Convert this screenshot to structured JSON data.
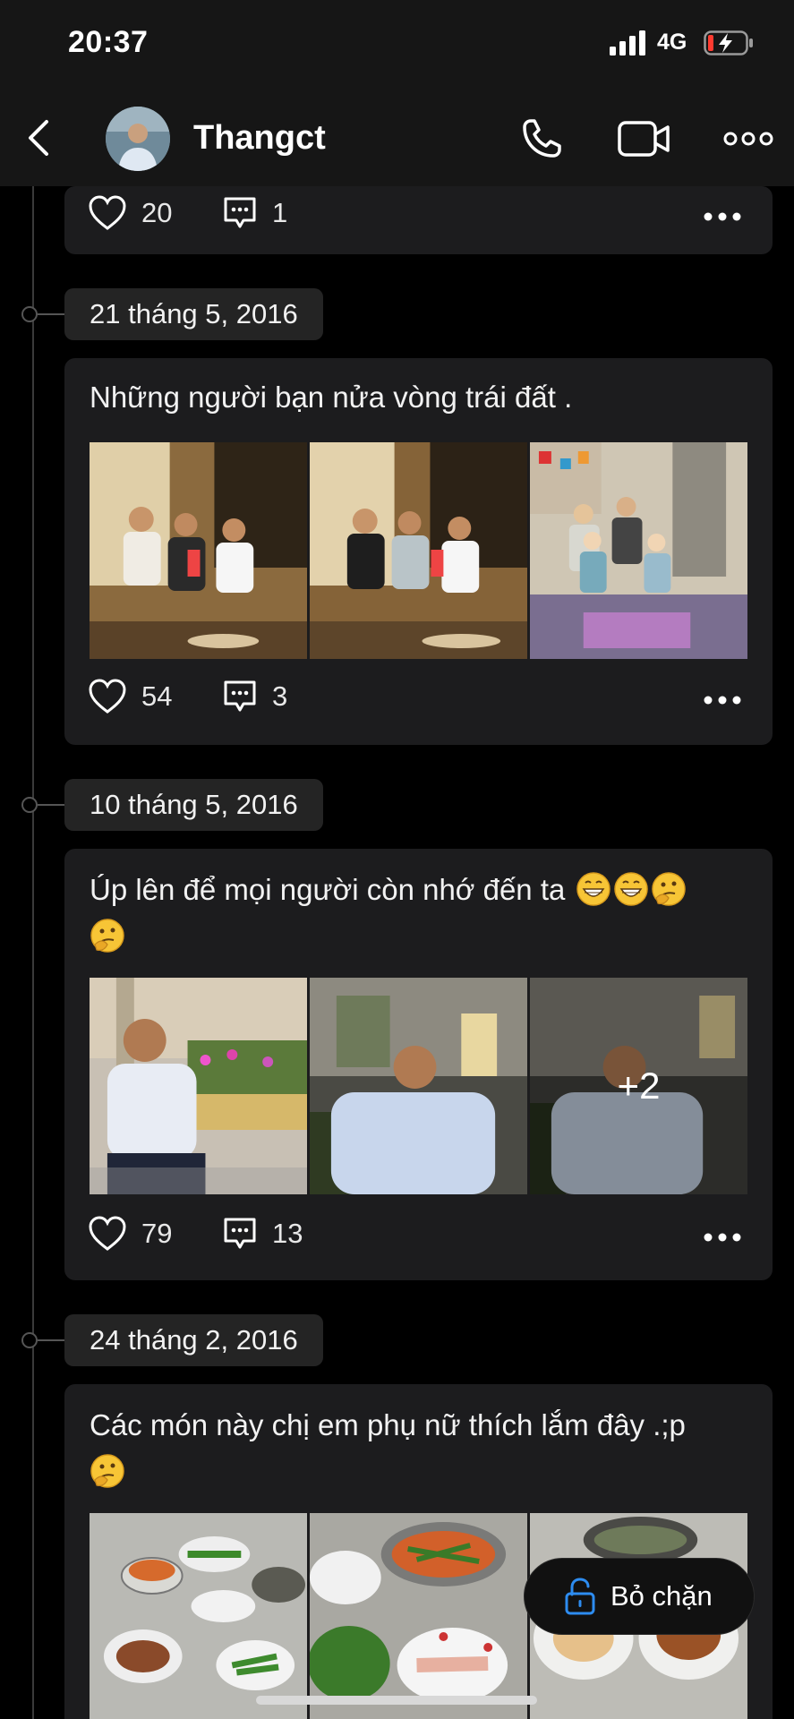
{
  "status_bar": {
    "time": "20:37",
    "network": "4G"
  },
  "header": {
    "contact_name": "Thangct"
  },
  "top_card": {
    "likes": "20",
    "comments": "1"
  },
  "posts": [
    {
      "date": "21 tháng 5, 2016",
      "caption": "Những người bạn nửa vòng trái đất .",
      "likes": "54",
      "comments": "3"
    },
    {
      "date": "10 tháng 5, 2016",
      "caption": "Úp lên để mọi người còn nhớ đến ta",
      "likes": "79",
      "comments": "13",
      "more_photos": "+2"
    },
    {
      "date": "24 tháng 2, 2016",
      "caption": "Các món này chị em phụ nữ thích lắm đây .;p"
    }
  ],
  "unblock_button": {
    "label": "Bỏ chặn"
  },
  "colors": {
    "background": "#000000",
    "card": "#1c1c1e",
    "date_pill": "#242424",
    "accent_blue": "#2d8cf0"
  }
}
